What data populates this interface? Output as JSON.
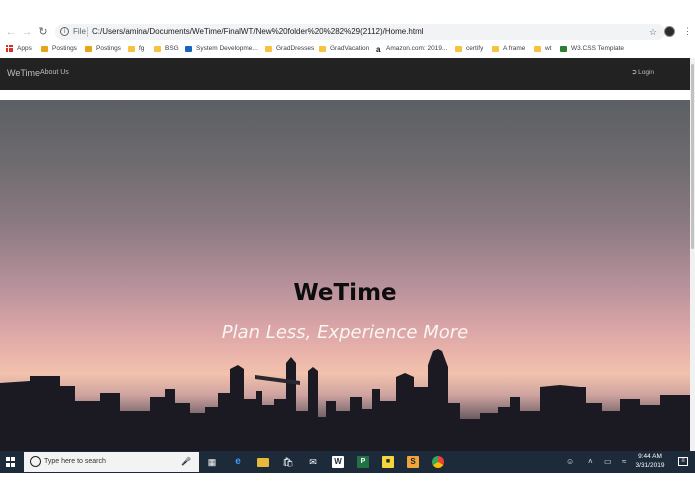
{
  "browser": {
    "file_label": "File",
    "url": "C:/Users/amina/Documents/WeTime/FinalWT/New%20folder%20%282%29(2112)/Home.html",
    "bookmarks": [
      {
        "label": "Apps",
        "icon": "apps-icon"
      },
      {
        "label": "Postings",
        "icon": "bookmark-favicon"
      },
      {
        "label": "Postings",
        "icon": "bookmark-favicon"
      },
      {
        "label": "fg",
        "icon": "folder-icon"
      },
      {
        "label": "BSG",
        "icon": "folder-icon"
      },
      {
        "label": "System Developme...",
        "icon": "bookmark-favicon"
      },
      {
        "label": "GradDresses",
        "icon": "folder-icon"
      },
      {
        "label": "GradVacation",
        "icon": "folder-icon"
      },
      {
        "label": "Amazon.com: 2019...",
        "icon": "amazon-icon"
      },
      {
        "label": "certify",
        "icon": "folder-icon"
      },
      {
        "label": "A frame",
        "icon": "folder-icon"
      },
      {
        "label": "wt",
        "icon": "folder-icon"
      },
      {
        "label": "W3.CSS Template",
        "icon": "bookmark-favicon"
      }
    ]
  },
  "site": {
    "brand": "WeTime",
    "nav_about": "About Us",
    "nav_login": "Login",
    "hero_title": "WeTime",
    "hero_subtitle": "Plan Less, Experience More"
  },
  "taskbar": {
    "search_placeholder": "Type here to search",
    "time": "9:44 AM",
    "date": "3/31/2019"
  },
  "colors": {
    "navbar_bg": "#222222",
    "taskbar_bg": "#1c2a3a",
    "folder": "#f5c242"
  }
}
